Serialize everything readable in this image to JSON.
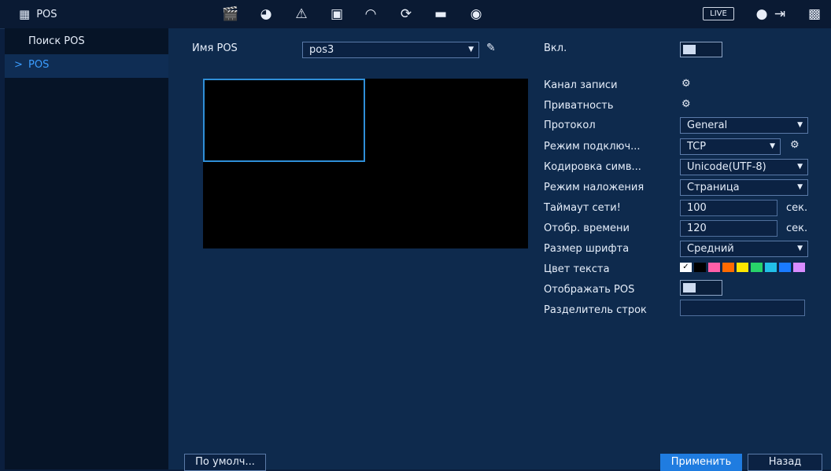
{
  "app": {
    "title": "POS"
  },
  "topbar": {
    "icons": [
      "clapperboard-icon",
      "head-icon",
      "alarm-icon",
      "network-icon",
      "gauge-icon",
      "refresh-icon",
      "monitor-icon",
      "audio-icon"
    ],
    "live_label": "LIVE"
  },
  "sidebar": {
    "items": [
      {
        "label": "Поиск POS",
        "active": false
      },
      {
        "label": "POS",
        "active": true
      }
    ],
    "active_marker": ">"
  },
  "form": {
    "pos_name_label": "Имя POS",
    "pos_name_value": "pos3",
    "enable_label": "Вкл.",
    "enable_on": true,
    "rows": {
      "record_channel": "Канал записи",
      "privacy": "Приватность",
      "protocol": "Протокол",
      "connect_mode": "Режим подключ...",
      "encoding": "Кодировка симв...",
      "overlay_mode": "Режим наложения",
      "net_timeout": "Таймаут сети!",
      "display_time": "Отобр. времени",
      "font_size": "Размер шрифта",
      "text_color": "Цвет текста",
      "show_pos": "Отображать POS",
      "line_delimiter": "Разделитель строк"
    },
    "values": {
      "protocol": "General",
      "connect_mode": "TCP",
      "encoding": "Unicode(UTF-8)",
      "overlay_mode": "Страница",
      "net_timeout": "100",
      "display_time": "120",
      "font_size": "Средний",
      "line_delimiter": "",
      "sec_unit": "сек."
    },
    "colors": [
      "#ffffff",
      "#000000",
      "#ff5fa8",
      "#ff6a00",
      "#ffe600",
      "#28d36a",
      "#22c0e8",
      "#1a7bff",
      "#d98cff"
    ]
  },
  "footer": {
    "default_label": "По умолч...",
    "apply_label": "Применить",
    "back_label": "Назад"
  }
}
